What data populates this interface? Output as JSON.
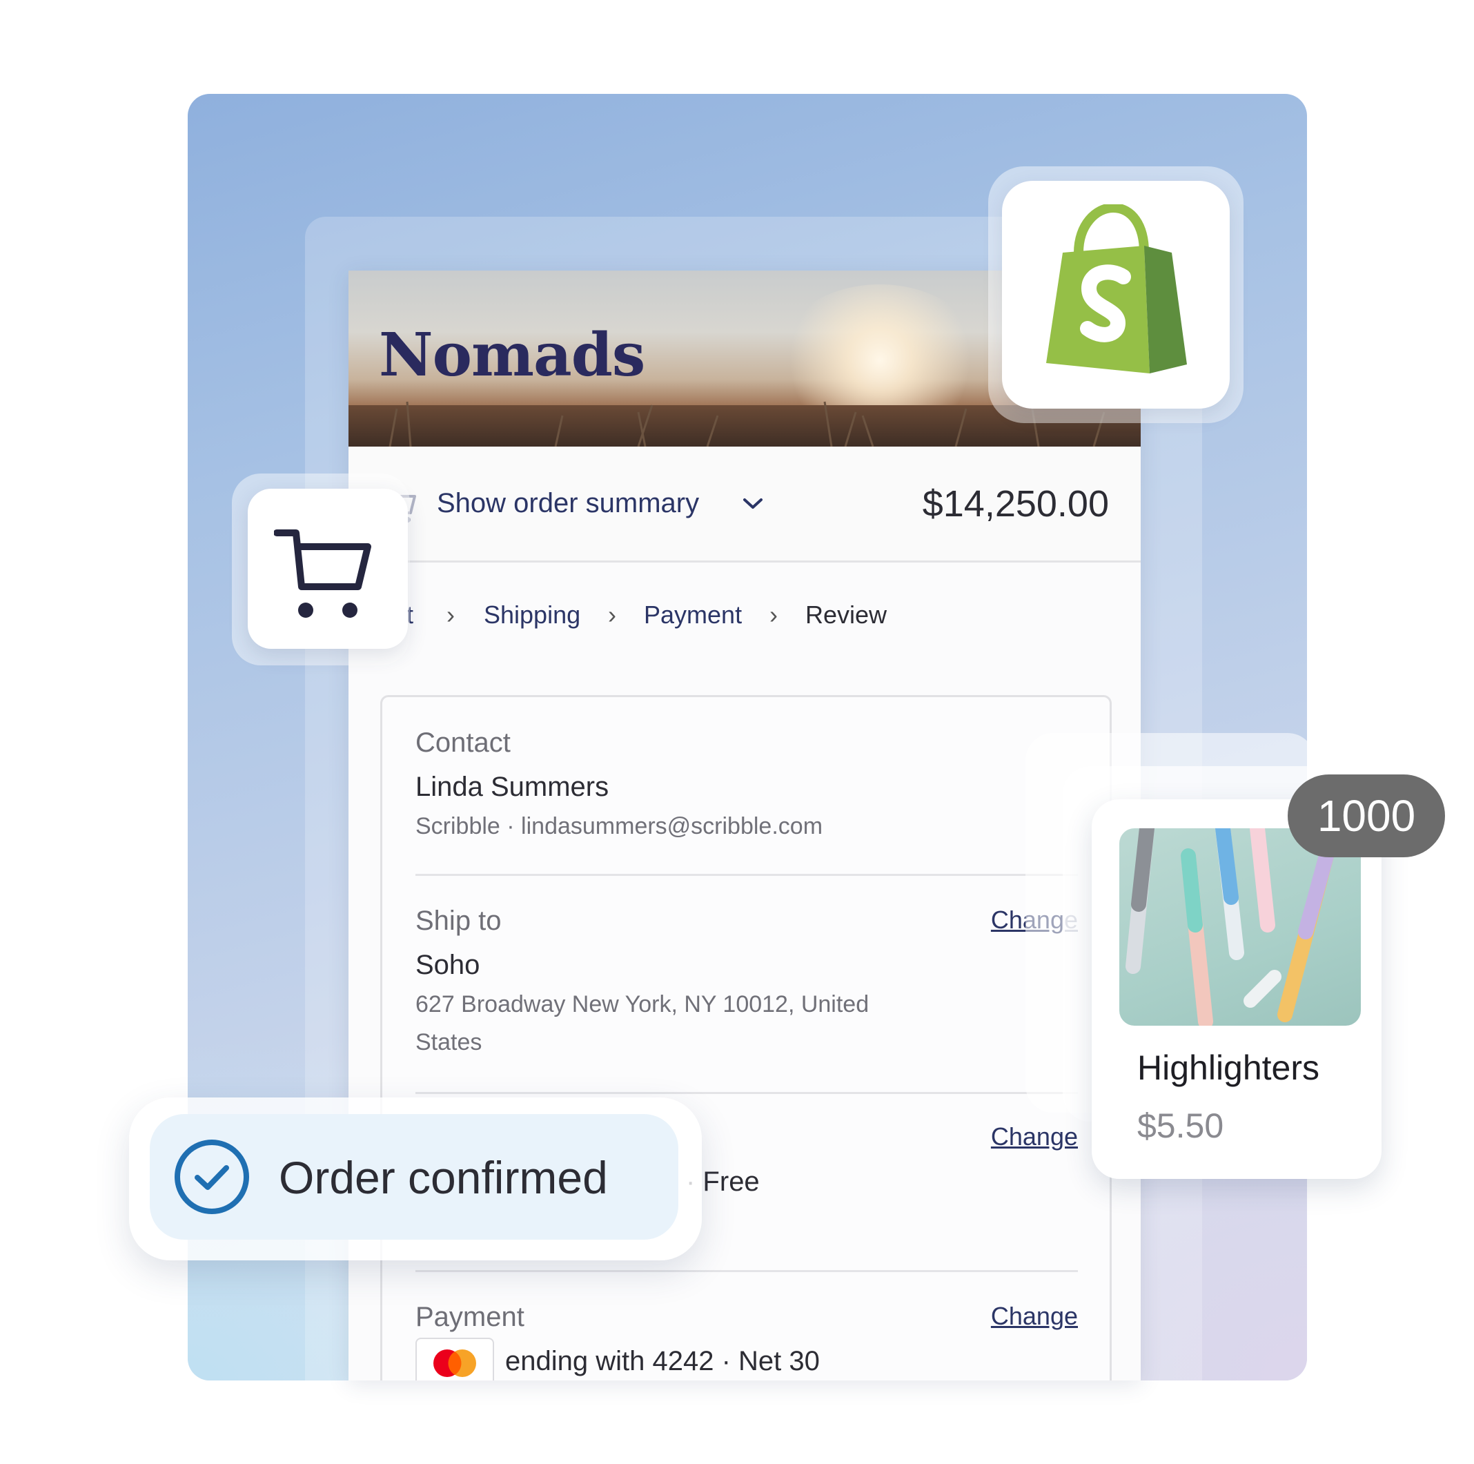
{
  "store": {
    "name": "Nomads"
  },
  "order_summary": {
    "toggle_label": "Show order summary",
    "total": "$14,250.00"
  },
  "breadcrumbs": {
    "cart": "rt",
    "items": [
      "Shipping",
      "Payment",
      "Review"
    ],
    "separator": "›"
  },
  "review": {
    "contact": {
      "label": "Contact",
      "name": "Linda Summers",
      "detail": "Scribble · lindasummers@scribble.com"
    },
    "ship_to": {
      "label": "Ship to",
      "name": "Soho",
      "address": "627 Broadway New York, NY 10012, United States",
      "change_label": "Change"
    },
    "shipping_method": {
      "detail": "· Free",
      "change_label": "Change"
    },
    "payment": {
      "label": "Payment",
      "detail": "ending with 4242 · Net 30",
      "change_label": "Change",
      "card_icon": "mastercard-icon"
    }
  },
  "product": {
    "name": "Highlighters",
    "price": "$5.50",
    "quantity": "1000"
  },
  "confirmation": {
    "text": "Order confirmed"
  },
  "colors": {
    "brand_navy": "#2a2a5e",
    "link": "#2b3566",
    "shopify_green_light": "#95bf47",
    "shopify_green_dark": "#5e8e3e",
    "confirm_blue": "#1f6fb2",
    "badge_gray": "#6c6c6c"
  },
  "icons": [
    "shopify-bag-icon",
    "cart-icon",
    "chevron-down-icon",
    "check-circle-icon",
    "mastercard-icon"
  ]
}
